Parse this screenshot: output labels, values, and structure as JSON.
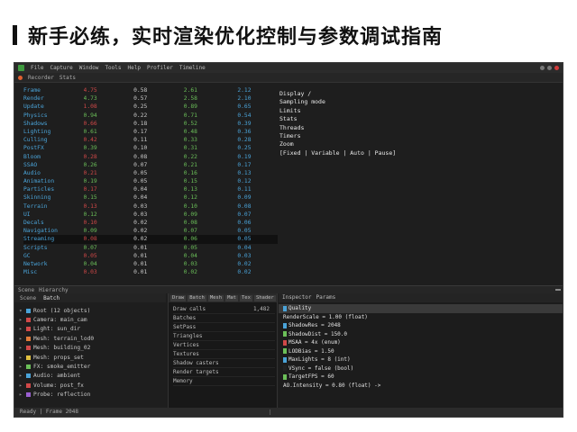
{
  "slide": {
    "title": "新手必练，实时渲染优化控制与参数调试指南"
  },
  "window": {
    "menu": [
      "File",
      "Capture",
      "Window",
      "Tools",
      "Help",
      "Profiler",
      "Timeline"
    ],
    "toolbar": [
      "Recorder",
      "Stats"
    ]
  },
  "stats_rows": [
    [
      "Frame",
      "4.75",
      "0.58",
      "2.61",
      "2.12"
    ],
    [
      "Render",
      "4.73",
      "0.57",
      "2.58",
      "2.10"
    ],
    [
      "Update",
      "1.08",
      "0.25",
      "0.89",
      "0.65"
    ],
    [
      "Physics",
      "0.94",
      "0.22",
      "0.71",
      "0.54"
    ],
    [
      "Shadows",
      "0.66",
      "0.18",
      "0.52",
      "0.39"
    ],
    [
      "Lighting",
      "0.61",
      "0.17",
      "0.48",
      "0.36"
    ],
    [
      "Culling",
      "0.42",
      "0.11",
      "0.33",
      "0.28"
    ],
    [
      "PostFX",
      "0.39",
      "0.10",
      "0.31",
      "0.25"
    ],
    [
      "Bloom",
      "0.28",
      "0.08",
      "0.22",
      "0.19"
    ],
    [
      "SSAO",
      "0.26",
      "0.07",
      "0.21",
      "0.17"
    ],
    [
      "Audio",
      "0.21",
      "0.05",
      "0.16",
      "0.13"
    ],
    [
      "Animation",
      "0.19",
      "0.05",
      "0.15",
      "0.12"
    ],
    [
      "Particles",
      "0.17",
      "0.04",
      "0.13",
      "0.11"
    ],
    [
      "Skinning",
      "0.15",
      "0.04",
      "0.12",
      "0.09"
    ],
    [
      "Terrain",
      "0.13",
      "0.03",
      "0.10",
      "0.08"
    ],
    [
      "UI",
      "0.12",
      "0.03",
      "0.09",
      "0.07"
    ],
    [
      "Decals",
      "0.10",
      "0.02",
      "0.08",
      "0.06"
    ],
    [
      "Navigation",
      "0.09",
      "0.02",
      "0.07",
      "0.05"
    ],
    [
      "Streaming",
      "0.08",
      "0.02",
      "0.06",
      "0.05"
    ],
    [
      "Scripts",
      "0.07",
      "0.01",
      "0.05",
      "0.04"
    ],
    [
      "GC",
      "0.05",
      "0.01",
      "0.04",
      "0.03"
    ],
    [
      "Network",
      "0.04",
      "0.01",
      "0.03",
      "0.02"
    ],
    [
      "Misc",
      "0.03",
      "0.01",
      "0.02",
      "0.02"
    ]
  ],
  "settings_lines": [
    "Display /",
    "Sampling mode",
    "Limits",
    "Stats",
    "Threads",
    "Timers",
    "Zoom",
    "[Fixed | Variable | Auto | Pause]"
  ],
  "splitter_tabs": [
    "Scene",
    "Hierarchy"
  ],
  "tree": {
    "tabs": [
      "Scene",
      "Batch"
    ],
    "rows": [
      {
        "arrow": "▾",
        "color": "#4aa3d8",
        "text": "Root (12 objects)"
      },
      {
        "arrow": "▸",
        "color": "#d04848",
        "text": "Camera: main_cam"
      },
      {
        "arrow": "▸",
        "color": "#d04848",
        "text": "Light: sun_dir"
      },
      {
        "arrow": "▸",
        "color": "#e07b3a",
        "text": "Mesh: terrain_lod0"
      },
      {
        "arrow": "▸",
        "color": "#d04848",
        "text": "Mesh: building_02"
      },
      {
        "arrow": "▸",
        "color": "#e0c040",
        "text": "Mesh: props_set"
      },
      {
        "arrow": "▸",
        "color": "#6bbf59",
        "text": "FX: smoke_emitter"
      },
      {
        "arrow": "▸",
        "color": "#4aa3d8",
        "text": "Audio: ambient"
      },
      {
        "arrow": "▸",
        "color": "#d04848",
        "text": "Volume: post_fx"
      },
      {
        "arrow": "▸",
        "color": "#9a5fd0",
        "text": "Probe: reflection"
      }
    ]
  },
  "mid": {
    "tabs": [
      "Draw",
      "Batch",
      "Mesh",
      "Mat",
      "Tex",
      "Shader"
    ],
    "rows": [
      {
        "label": "Draw calls",
        "value": "1,482"
      },
      {
        "label": "Batches",
        "value": ""
      },
      {
        "label": "SetPass",
        "value": ""
      },
      {
        "label": "Triangles",
        "value": ""
      },
      {
        "label": "Vertices",
        "value": ""
      },
      {
        "label": "Textures",
        "value": ""
      },
      {
        "label": "Shadow casters",
        "value": ""
      },
      {
        "label": "Render targets",
        "value": ""
      },
      {
        "label": "Memory",
        "value": ""
      }
    ]
  },
  "right": {
    "head": [
      "Inspector",
      "Params"
    ],
    "rows": [
      {
        "color": "#4aa3d8",
        "text": "Quality",
        "sel": true
      },
      {
        "color": "",
        "text": "RenderScale = 1.00 (float)"
      },
      {
        "color": "#4aa3d8",
        "text": "ShadowRes = 2048"
      },
      {
        "color": "#6bbf59",
        "text": "ShadowDist = 150.0"
      },
      {
        "color": "#d04848",
        "text": "MSAA = 4x (enum)"
      },
      {
        "color": "#6bbf59",
        "text": "LODBias = 1.50"
      },
      {
        "color": "#4aa3d8",
        "text": "MaxLights = 8 (int)"
      },
      {
        "color": "#222222",
        "text": "VSync = false (bool)"
      },
      {
        "color": "#6bbf59",
        "text": "TargetFPS = 60"
      },
      {
        "color": "",
        "text": "AO.Intensity = 0.80 (float) ->"
      }
    ]
  },
  "statusbar": {
    "text": "Ready | Frame 2048"
  }
}
